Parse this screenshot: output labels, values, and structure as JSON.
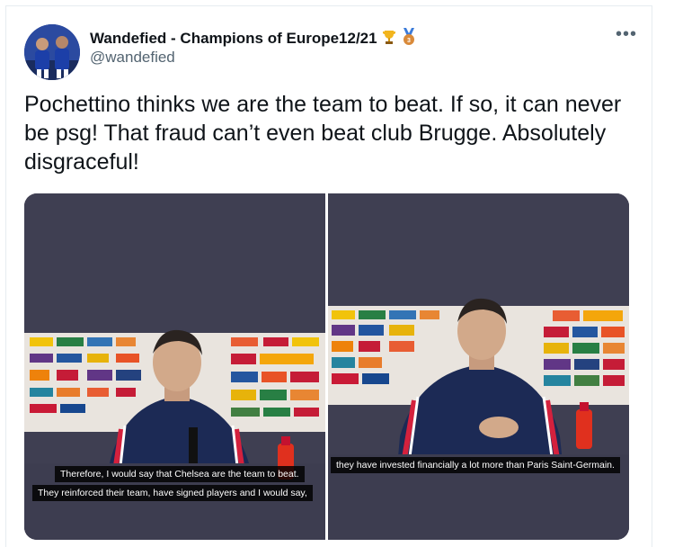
{
  "tweet": {
    "author_name": "Wandefied - Champions of Europe12/21",
    "author_handle": "@wandefied",
    "name_badges": [
      "trophy-icon",
      "bronze-medal-icon"
    ],
    "more_label": "•••",
    "text": "Pochettino thinks we are the team to beat. If so, it can never be psg! That fraud can’t even beat club Brugge. Absolutely disgraceful!"
  },
  "media": {
    "left_captions": [
      "Therefore, I would say that Chelsea are the team to beat.",
      "They reinforced their team, have signed players and I would say,"
    ],
    "right_captions": [
      "they have invested financially a lot more than Paris Saint-Germain."
    ]
  },
  "colors": {
    "text": "#0f1419",
    "secondary": "#536471",
    "media_bg": "#3f3f52",
    "psg_navy": "#1c2a55",
    "psg_red": "#d4213d"
  }
}
